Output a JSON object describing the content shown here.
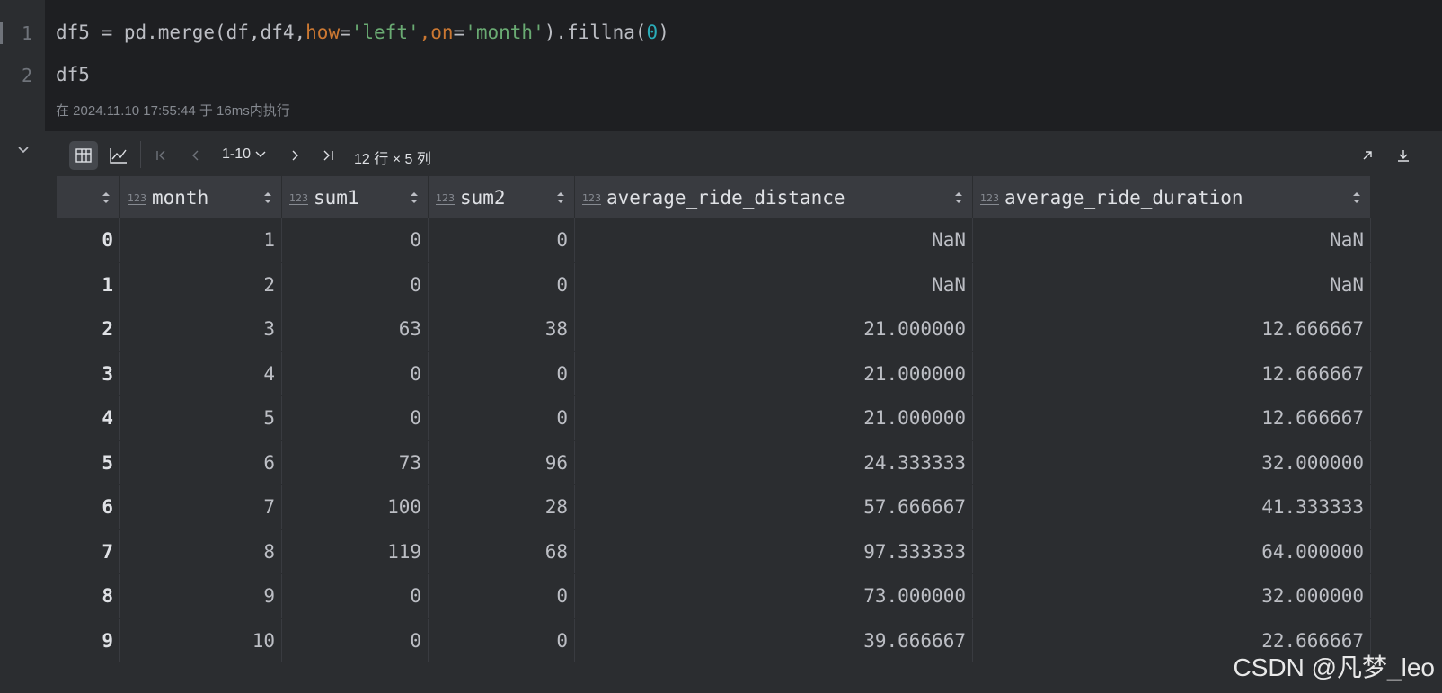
{
  "editor": {
    "line_numbers": [
      "1",
      "2"
    ],
    "line1": {
      "p1": "df5 = pd.merge(df,df4,",
      "kw_how": "how",
      "eq1": "=",
      "str_left": "'left'",
      "comma": ",",
      "kw_on": "on",
      "eq2": "=",
      "str_month": "'month'",
      "p2": ").fillna(",
      "num_zero": "0",
      "p3": ")"
    },
    "line2": "df5",
    "exec_info": "在 2024.11.10 17:55:44 于 16ms内执行"
  },
  "toolbar": {
    "page_range": "1-10",
    "shape": "12 行 × 5 列"
  },
  "table": {
    "columns": [
      "",
      "month",
      "sum1",
      "sum2",
      "average_ride_distance",
      "average_ride_duration"
    ],
    "type_badge": "123",
    "rows": [
      [
        "0",
        "1",
        "0",
        "0",
        "NaN",
        "NaN"
      ],
      [
        "1",
        "2",
        "0",
        "0",
        "NaN",
        "NaN"
      ],
      [
        "2",
        "3",
        "63",
        "38",
        "21.000000",
        "12.666667"
      ],
      [
        "3",
        "4",
        "0",
        "0",
        "21.000000",
        "12.666667"
      ],
      [
        "4",
        "5",
        "0",
        "0",
        "21.000000",
        "12.666667"
      ],
      [
        "5",
        "6",
        "73",
        "96",
        "24.333333",
        "32.000000"
      ],
      [
        "6",
        "7",
        "100",
        "28",
        "57.666667",
        "41.333333"
      ],
      [
        "7",
        "8",
        "119",
        "68",
        "97.333333",
        "64.000000"
      ],
      [
        "8",
        "9",
        "0",
        "0",
        "73.000000",
        "32.000000"
      ],
      [
        "9",
        "10",
        "0",
        "0",
        "39.666667",
        "22.666667"
      ]
    ]
  },
  "watermark": "CSDN @凡梦_leo",
  "colors": {
    "editor_bg": "#1e1f22",
    "panel_bg": "#2b2d30",
    "header_bg": "#393b40",
    "keyword": "#cc7832",
    "string": "#6aab73",
    "number": "#2aacb8"
  }
}
